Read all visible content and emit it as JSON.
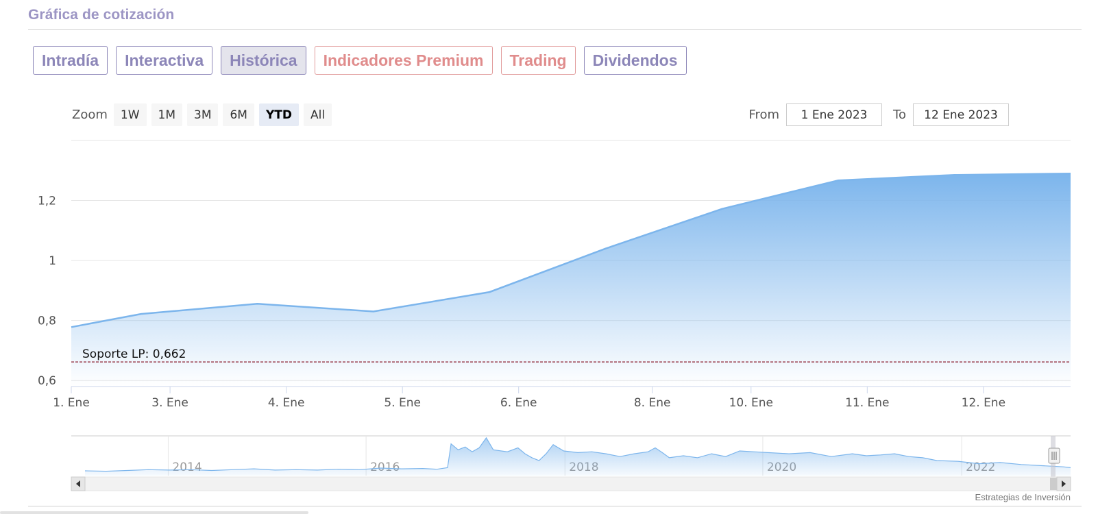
{
  "section_title": "Gráfica de cotización",
  "tabs": [
    {
      "label": "Intradía",
      "style": "normal"
    },
    {
      "label": "Interactiva",
      "style": "normal"
    },
    {
      "label": "Histórica",
      "style": "active"
    },
    {
      "label": "Indicadores Premium",
      "style": "premium"
    },
    {
      "label": "Trading",
      "style": "premium"
    },
    {
      "label": "Dividendos",
      "style": "normal"
    }
  ],
  "zoom": {
    "label": "Zoom",
    "buttons": [
      "1W",
      "1M",
      "3M",
      "6M",
      "YTD",
      "All"
    ],
    "selected": "YTD"
  },
  "range": {
    "from_label": "From",
    "from_value": "1 Ene 2023",
    "to_label": "To",
    "to_value": "12 Ene 2023"
  },
  "credit": "Estrategias de Inversión",
  "colors": {
    "series": "#7cb5ec",
    "support_line": "#8b1a2b",
    "accent_purple": "#8c86b8",
    "accent_red": "#e08c8c"
  },
  "chart_data": {
    "type": "area",
    "x": [
      0,
      1,
      2,
      3,
      4,
      5,
      6,
      7,
      8,
      9
    ],
    "x_tick_labels": [
      "1. Ene",
      "3. Ene",
      "4. Ene",
      "5. Ene",
      "6. Ene",
      "8. Ene",
      "10. Ene",
      "11. Ene",
      "12. Ene"
    ],
    "x_tick_positions": [
      0,
      0.85,
      1.85,
      2.85,
      3.85,
      5.0,
      5.85,
      6.85,
      7.85
    ],
    "series": [
      {
        "x": [
          0,
          0.6,
          1.6,
          2.6,
          3.6,
          4.6,
          5.6,
          6.6,
          7.6,
          8.6
        ],
        "y": [
          0.778,
          0.822,
          0.856,
          0.83,
          0.895,
          1.04,
          1.172,
          1.267,
          1.285,
          1.29
        ]
      }
    ],
    "xlim": [
      0,
      8.6
    ],
    "ylim": [
      0.58,
      1.4
    ],
    "y_ticks": [
      0.6,
      0.8,
      1,
      1.2
    ],
    "y_tick_labels": [
      "0,6",
      "0,8",
      "1",
      "1,2"
    ],
    "plot_lines": [
      {
        "label": "Soporte LP: 0,662",
        "value": 0.662,
        "style": "dashed"
      }
    ],
    "grid": true,
    "navigator": {
      "year_labels": [
        "2014",
        "2016",
        "2018",
        "2020",
        "2022"
      ],
      "year_positions": [
        0.097,
        0.295,
        0.494,
        0.692,
        0.891
      ],
      "series": [
        [
          0.0,
          0.12
        ],
        [
          0.03,
          0.11
        ],
        [
          0.06,
          0.13
        ],
        [
          0.09,
          0.15
        ],
        [
          0.12,
          0.14
        ],
        [
          0.15,
          0.15
        ],
        [
          0.18,
          0.13
        ],
        [
          0.21,
          0.15
        ],
        [
          0.24,
          0.17
        ],
        [
          0.27,
          0.14
        ],
        [
          0.3,
          0.15
        ],
        [
          0.33,
          0.14
        ],
        [
          0.36,
          0.16
        ],
        [
          0.39,
          0.15
        ],
        [
          0.42,
          0.19
        ],
        [
          0.45,
          0.17
        ],
        [
          0.48,
          0.18
        ],
        [
          0.5,
          0.16
        ],
        [
          0.515,
          0.2
        ],
        [
          0.52,
          0.8
        ],
        [
          0.53,
          0.65
        ],
        [
          0.54,
          0.72
        ],
        [
          0.55,
          0.6
        ],
        [
          0.56,
          0.7
        ],
        [
          0.57,
          0.95
        ],
        [
          0.58,
          0.65
        ],
        [
          0.6,
          0.6
        ],
        [
          0.615,
          0.7
        ],
        [
          0.625,
          0.55
        ],
        [
          0.635,
          0.45
        ],
        [
          0.645,
          0.38
        ],
        [
          0.655,
          0.55
        ],
        [
          0.665,
          0.78
        ],
        [
          0.68,
          0.62
        ],
        [
          0.7,
          0.58
        ],
        [
          0.72,
          0.6
        ],
        [
          0.74,
          0.55
        ],
        [
          0.76,
          0.48
        ],
        [
          0.78,
          0.55
        ],
        [
          0.8,
          0.6
        ],
        [
          0.81,
          0.7
        ],
        [
          0.82,
          0.58
        ],
        [
          0.83,
          0.45
        ],
        [
          0.85,
          0.5
        ],
        [
          0.87,
          0.45
        ],
        [
          0.89,
          0.55
        ],
        [
          0.91,
          0.48
        ],
        [
          0.93,
          0.62
        ],
        [
          0.95,
          0.6
        ],
        [
          0.97,
          0.58
        ],
        [
          1.0,
          0.55
        ],
        [
          1.03,
          0.58
        ],
        [
          1.06,
          0.48
        ],
        [
          1.09,
          0.55
        ],
        [
          1.11,
          0.5
        ],
        [
          1.13,
          0.52
        ],
        [
          1.15,
          0.55
        ],
        [
          1.17,
          0.48
        ],
        [
          1.19,
          0.45
        ],
        [
          1.21,
          0.38
        ],
        [
          1.24,
          0.36
        ],
        [
          1.27,
          0.3
        ],
        [
          1.3,
          0.33
        ],
        [
          1.33,
          0.28
        ],
        [
          1.36,
          0.25
        ],
        [
          1.39,
          0.22
        ],
        [
          1.4,
          0.2
        ]
      ],
      "series_xlim": [
        0,
        1.4
      ]
    }
  }
}
